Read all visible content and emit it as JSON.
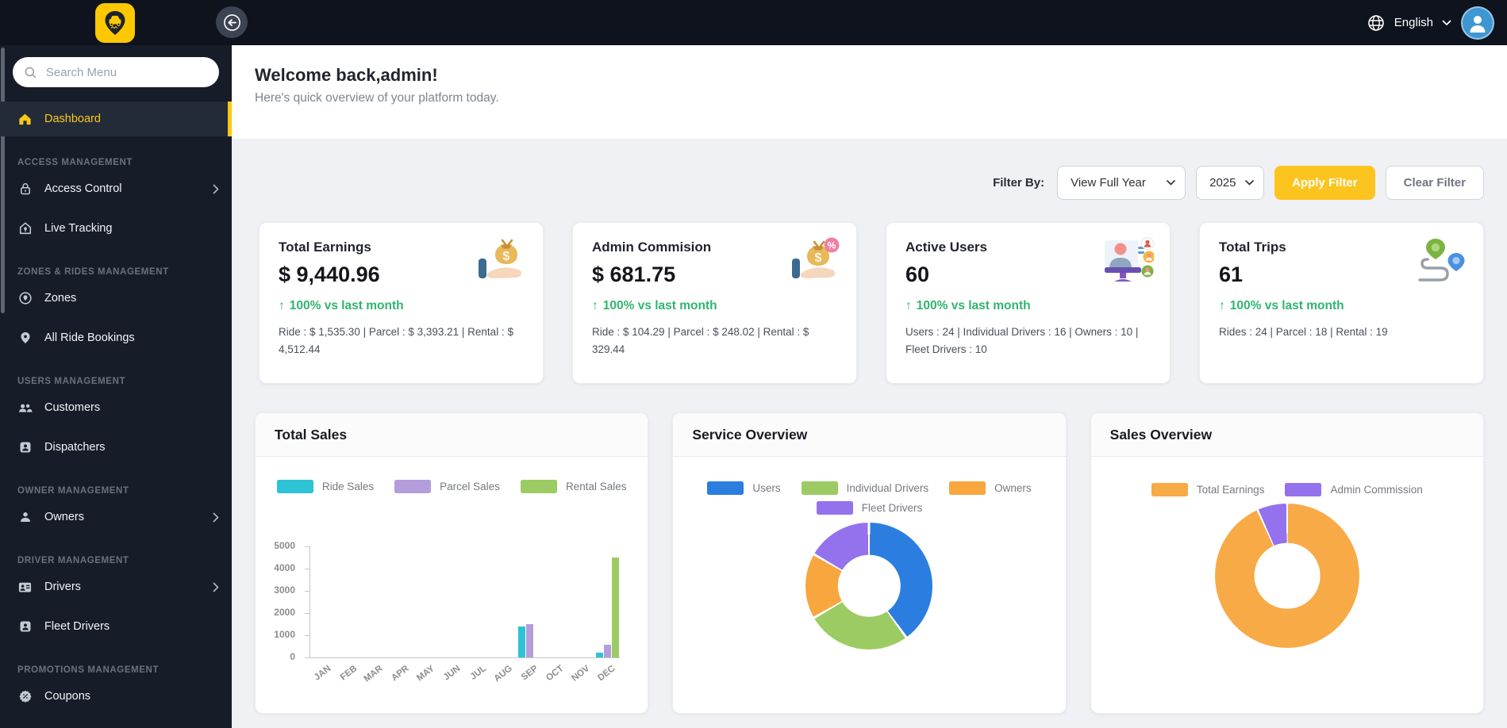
{
  "topbar": {
    "language": "English"
  },
  "sidebar": {
    "search_placeholder": "Search Menu",
    "sections": [
      {
        "header": "",
        "items": [
          {
            "label": "Dashboard"
          }
        ]
      },
      {
        "header": "ACCESS MANAGEMENT",
        "items": [
          {
            "label": "Access Control"
          },
          {
            "label": "Live Tracking"
          }
        ]
      },
      {
        "header": "ZONES & RIDES MANAGEMENT",
        "items": [
          {
            "label": "Zones"
          },
          {
            "label": "All Ride Bookings"
          }
        ]
      },
      {
        "header": "USERS MANAGEMENT",
        "items": [
          {
            "label": "Customers"
          },
          {
            "label": "Dispatchers"
          }
        ]
      },
      {
        "header": "OWNER MANAGEMENT",
        "items": [
          {
            "label": "Owners"
          }
        ]
      },
      {
        "header": "DRIVER MANAGEMENT",
        "items": [
          {
            "label": "Drivers"
          },
          {
            "label": "Fleet Drivers"
          }
        ]
      },
      {
        "header": "PROMOTIONS MANAGEMENT",
        "items": [
          {
            "label": "Coupons"
          }
        ]
      }
    ]
  },
  "header": {
    "title": "Welcome back,admin!",
    "subtitle": "Here's quick overview of your platform today."
  },
  "filter": {
    "label": "Filter By:",
    "period_value": "View Full Year",
    "year_value": "2025",
    "apply_label": "Apply Filter",
    "clear_label": "Clear Filter"
  },
  "stats": [
    {
      "label": "Total Earnings",
      "value": "$ 9,440.96",
      "trend": "100% vs last month",
      "breakdown": "Ride : $ 1,535.30 | Parcel : $ 3,393.21 | Rental : $ 4,512.44"
    },
    {
      "label": "Admin Commision",
      "value": "$ 681.75",
      "trend": "100% vs last month",
      "breakdown": "Ride : $ 104.29 | Parcel : $ 248.02 | Rental : $ 329.44"
    },
    {
      "label": "Active Users",
      "value": "60",
      "trend": "100% vs last month",
      "breakdown": "Users : 24 | Individual Drivers : 16 | Owners : 10 | Fleet Drivers : 10"
    },
    {
      "label": "Total Trips",
      "value": "61",
      "trend": "100% vs last month",
      "breakdown": "Rides : 24 | Parcel : 18 | Rental : 19"
    }
  ],
  "chart_data": [
    {
      "type": "bar",
      "title": "Total Sales",
      "categories": [
        "JAN",
        "FEB",
        "MAR",
        "APR",
        "MAY",
        "JUN",
        "JUL",
        "AUG",
        "SEP",
        "OCT",
        "NOV",
        "DEC"
      ],
      "series": [
        {
          "name": "Ride Sales",
          "color": "#2dc3d6",
          "values": [
            0,
            0,
            0,
            0,
            0,
            0,
            0,
            0,
            1400,
            0,
            0,
            210
          ]
        },
        {
          "name": "Parcel Sales",
          "color": "#b49ddb",
          "values": [
            0,
            0,
            0,
            0,
            0,
            0,
            0,
            0,
            1490,
            0,
            0,
            580
          ]
        },
        {
          "name": "Rental Sales",
          "color": "#9ccb63",
          "values": [
            0,
            0,
            0,
            0,
            0,
            0,
            0,
            0,
            0,
            0,
            0,
            4510
          ]
        }
      ],
      "xlabel": "",
      "ylabel": "",
      "ylim": [
        0,
        5000
      ],
      "yticks": [
        0,
        1000,
        2000,
        3000,
        4000,
        5000
      ],
      "grid": false,
      "legend_position": "top"
    },
    {
      "type": "donut",
      "title": "Service Overview",
      "segments": [
        {
          "label": "Users",
          "value": 24,
          "color": "#2b7de0"
        },
        {
          "label": "Individual Drivers",
          "value": 16,
          "color": "#9ccb63"
        },
        {
          "label": "Owners",
          "value": 10,
          "color": "#f8a63e"
        },
        {
          "label": "Fleet Drivers",
          "value": 10,
          "color": "#9472ee"
        }
      ],
      "hole": 0.49,
      "gap_deg": 2.2,
      "legend_position": "top"
    },
    {
      "type": "donut",
      "title": "Sales Overview",
      "segments": [
        {
          "label": "Total Earnings",
          "value": 9440.96,
          "color": "#f8aa47"
        },
        {
          "label": "Admin Commission",
          "value": 681.75,
          "color": "#9472ee"
        }
      ],
      "hole": 0.455,
      "gap_deg": 1.6,
      "legend_position": "top"
    }
  ],
  "colors": {
    "accent_yellow": "#fdc716",
    "trend_green": "#2fb56d",
    "topbar_bg": "#0e131d",
    "sidebar_bg": "#171d28",
    "avatar_blue": "#3e97d1"
  }
}
